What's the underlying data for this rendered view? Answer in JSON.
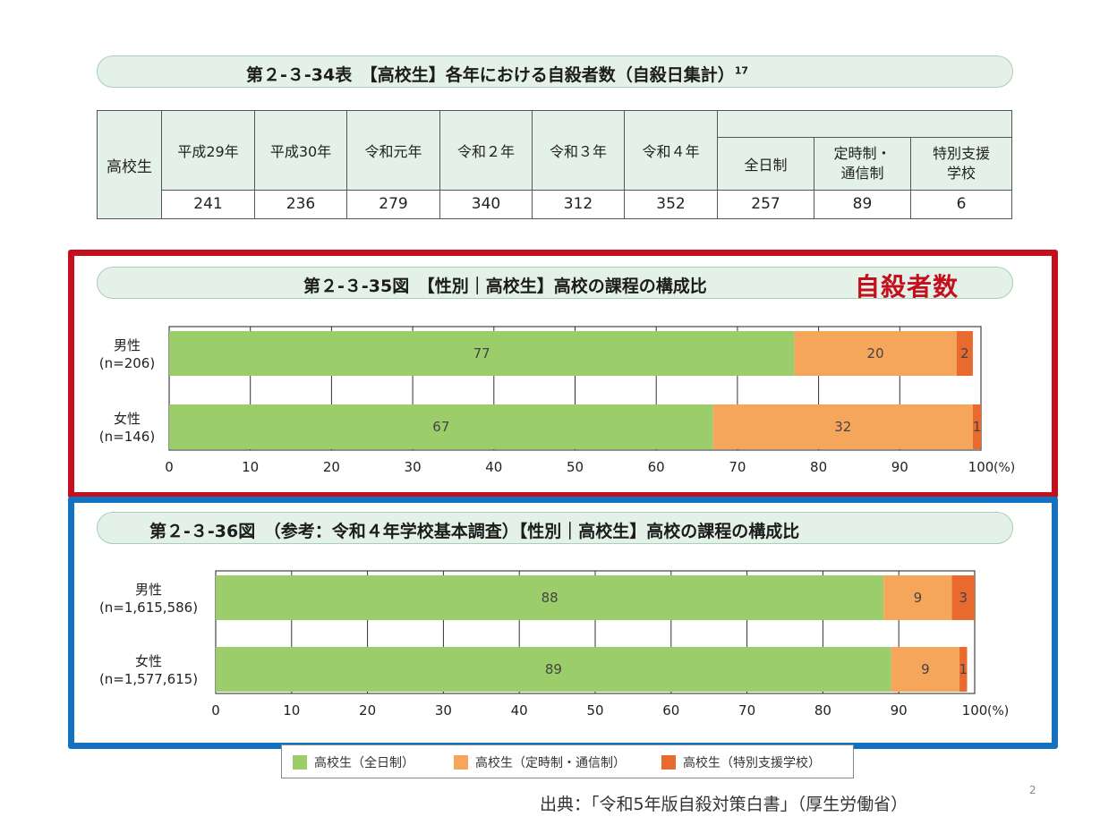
{
  "colors": {
    "full_time": "#9bcd6b",
    "part_time": "#f5a65b",
    "special": "#e96a2e",
    "red": "#c40f1c",
    "blue": "#1471bf"
  },
  "table34": {
    "title": "第２-３-34表　【高校生】各年における自殺者数（自殺日集計）",
    "title_sup": "17",
    "row_header": "高校生",
    "years": [
      "平成29年",
      "平成30年",
      "令和元年",
      "令和２年",
      "令和３年",
      "令和４年"
    ],
    "sub_headers": [
      "全日制",
      "定時制・\n通信制",
      "特別支援\n学校"
    ],
    "values": [
      "241",
      "236",
      "279",
      "340",
      "312",
      "352"
    ],
    "sub_values": [
      "257",
      "89",
      "6"
    ]
  },
  "fig35": {
    "title": "第２-３-35図　【性別｜高校生】高校の課程の構成比",
    "label": "自殺者数"
  },
  "fig36": {
    "title": "第２-３-36図　（参考：令和４年学校基本調査）【性別｜高校生】高校の課程の構成比"
  },
  "chart_data": [
    {
      "type": "bar",
      "orientation": "horizontal",
      "stacked": true,
      "title": "第２-３-35図　【性別｜高校生】高校の課程の構成比",
      "categories": [
        {
          "name": "男性",
          "n": "(n=206)"
        },
        {
          "name": "女性",
          "n": "(n=146)"
        }
      ],
      "series": [
        {
          "name": "高校生（全日制）",
          "values": [
            77,
            67
          ]
        },
        {
          "name": "高校生（定時制・通信制）",
          "values": [
            20,
            32
          ]
        },
        {
          "name": "高校生（特別支援学校）",
          "values": [
            2,
            1
          ]
        }
      ],
      "xlim": [
        0,
        100
      ],
      "xticks": [
        "0",
        "10",
        "20",
        "30",
        "40",
        "50",
        "60",
        "70",
        "80",
        "90",
        "100"
      ],
      "unit": "(%)",
      "grid": true
    },
    {
      "type": "bar",
      "orientation": "horizontal",
      "stacked": true,
      "title": "第２-３-36図　（参考：令和４年学校基本調査）【性別｜高校生】高校の課程の構成比",
      "categories": [
        {
          "name": "男性",
          "n": "(n=1,615,586)"
        },
        {
          "name": "女性",
          "n": "(n=1,577,615)"
        }
      ],
      "series": [
        {
          "name": "高校生（全日制）",
          "values": [
            88,
            89
          ]
        },
        {
          "name": "高校生（定時制・通信制）",
          "values": [
            9,
            9
          ]
        },
        {
          "name": "高校生（特別支援学校）",
          "values": [
            3,
            1
          ]
        }
      ],
      "xlim": [
        0,
        100
      ],
      "xticks": [
        "0",
        "10",
        "20",
        "30",
        "40",
        "50",
        "60",
        "70",
        "80",
        "90",
        "100"
      ],
      "unit": "(%)",
      "grid": true
    }
  ],
  "legend": [
    "高校生（全日制）",
    "高校生（定時制・通信制）",
    "高校生（特別支援学校）"
  ],
  "source": "出典：「令和5年版自殺対策白書」（厚生労働省）",
  "page_number": "2"
}
